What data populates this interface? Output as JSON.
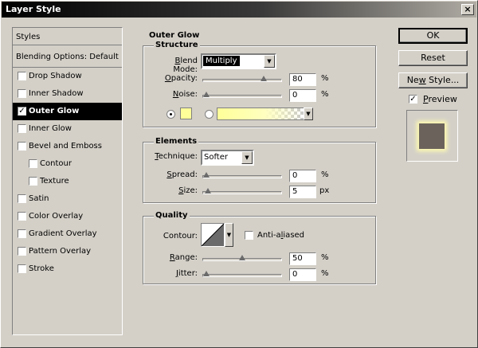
{
  "window": {
    "title": "Layer Style",
    "close_glyph": "×"
  },
  "styles_list": {
    "header": "Styles",
    "blending": "Blending Options: Default",
    "items": [
      {
        "label": "Drop Shadow",
        "checked": false
      },
      {
        "label": "Inner Shadow",
        "checked": false
      },
      {
        "label": "Outer Glow",
        "checked": true,
        "selected": true
      },
      {
        "label": "Inner Glow",
        "checked": false
      },
      {
        "label": "Bevel and Emboss",
        "checked": false
      },
      {
        "label": "Contour",
        "checked": false,
        "indent": true
      },
      {
        "label": "Texture",
        "checked": false,
        "indent": true
      },
      {
        "label": "Satin",
        "checked": false
      },
      {
        "label": "Color Overlay",
        "checked": false
      },
      {
        "label": "Gradient Overlay",
        "checked": false
      },
      {
        "label": "Pattern Overlay",
        "checked": false
      },
      {
        "label": "Stroke",
        "checked": false
      }
    ]
  },
  "panel": {
    "title": "Outer Glow",
    "structure": {
      "title": "Structure",
      "blend_mode_label": "Blend Mode:",
      "blend_mode_value": "Multiply",
      "opacity_label": "Opacity:",
      "opacity_value": "80",
      "opacity_fraction": 0.8,
      "noise_label": "Noise:",
      "noise_value": "0",
      "noise_fraction": 0,
      "percent": "%",
      "glow_color": "#ffff99"
    },
    "elements": {
      "title": "Elements",
      "technique_label": "Technique:",
      "technique_value": "Softer",
      "spread_label": "Spread:",
      "spread_value": "0",
      "spread_fraction": 0,
      "size_label": "Size:",
      "size_value": "5",
      "size_fraction": 0.02,
      "percent": "%",
      "px": "px"
    },
    "quality": {
      "title": "Quality",
      "contour_label": "Contour:",
      "anti_aliased_label": "Anti-aliased",
      "range_label": "Range:",
      "range_value": "50",
      "range_fraction": 0.5,
      "jitter_label": "Jitter:",
      "jitter_value": "0",
      "jitter_fraction": 0,
      "percent": "%"
    }
  },
  "buttons": {
    "ok": "OK",
    "reset": "Reset",
    "new_style": "New Style...",
    "preview_label": "Preview",
    "preview_checked": true
  },
  "colors": {
    "preview_swatch": "#6b635b",
    "preview_glow": "#fffbb0"
  }
}
